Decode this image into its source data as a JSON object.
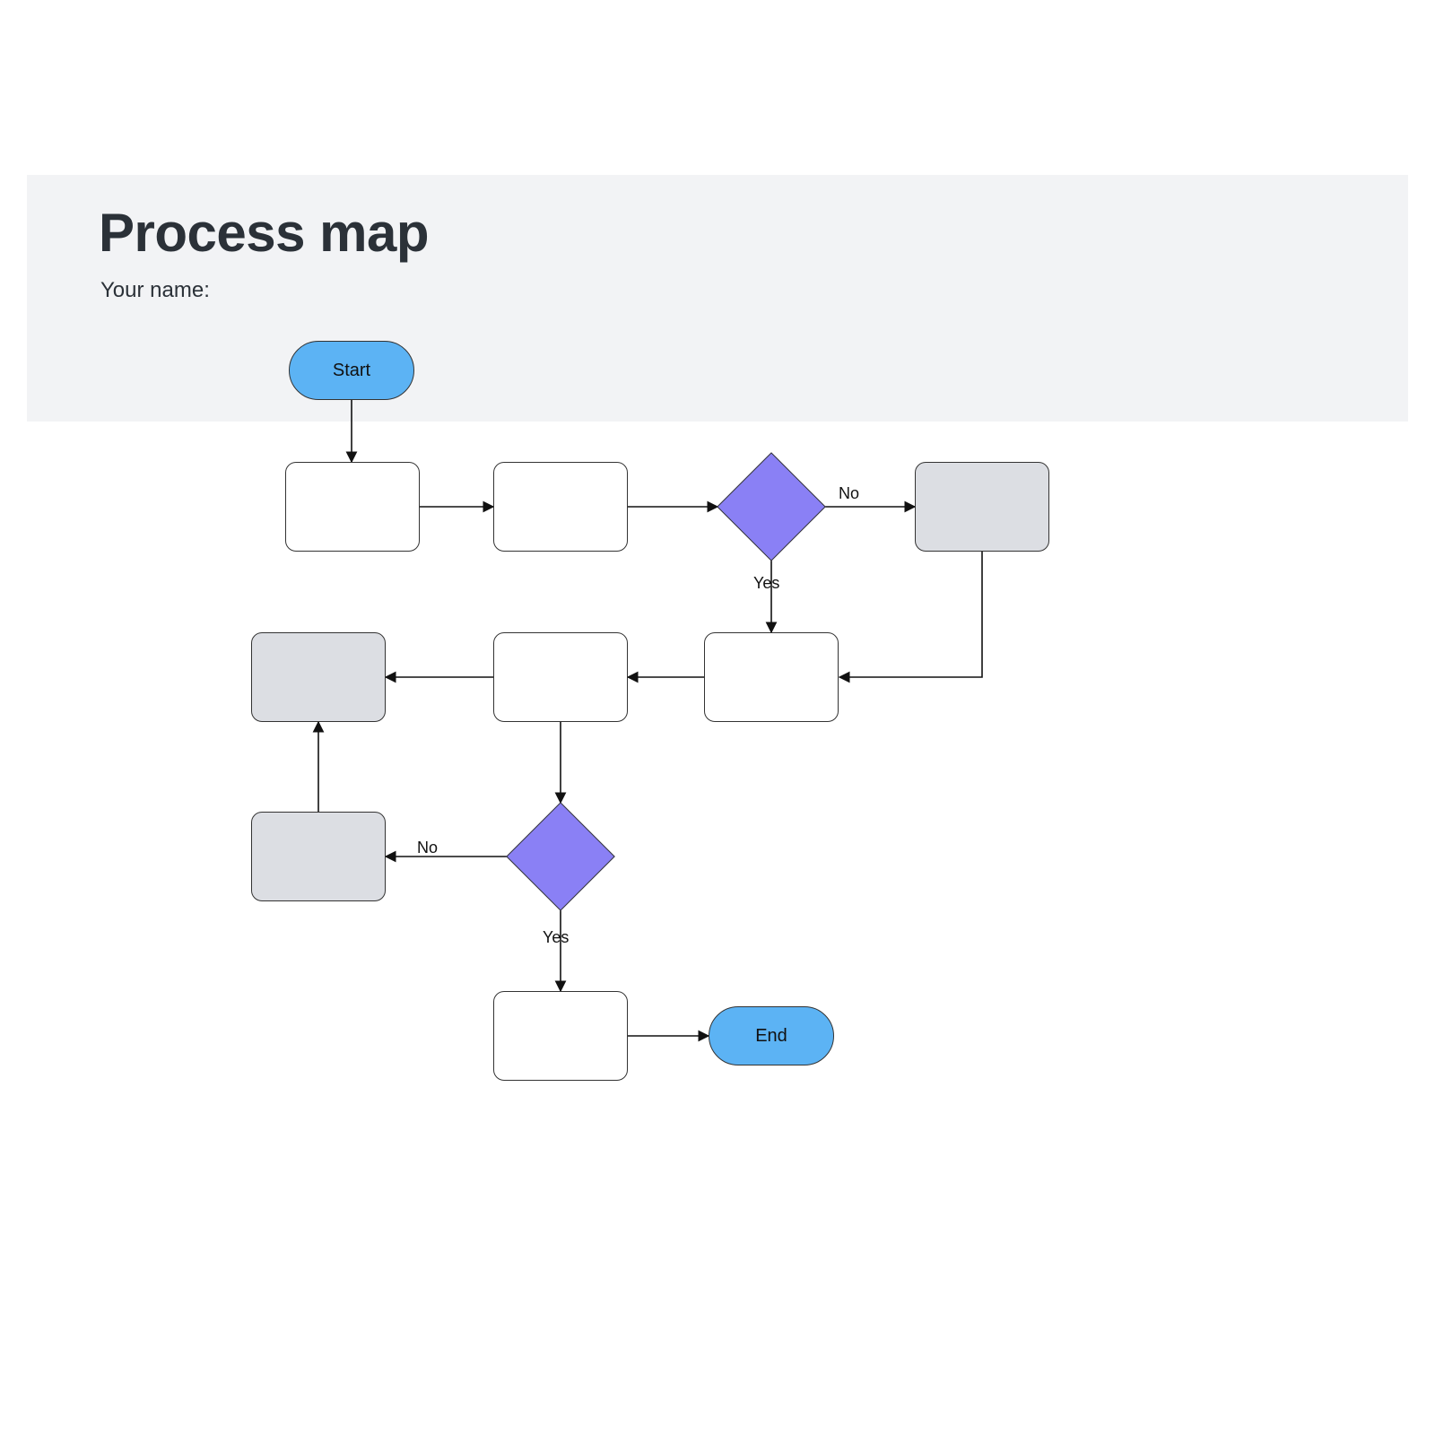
{
  "header": {
    "title": "Process map",
    "subtitle": "Your name:"
  },
  "nodes": {
    "start": {
      "label": "Start"
    },
    "end": {
      "label": "End"
    },
    "p1": {
      "label": ""
    },
    "p2": {
      "label": ""
    },
    "d1": {
      "label": ""
    },
    "p3": {
      "label": ""
    },
    "p4": {
      "label": ""
    },
    "p5": {
      "label": ""
    },
    "p6": {
      "label": ""
    },
    "d2": {
      "label": ""
    },
    "p7": {
      "label": ""
    },
    "p8": {
      "label": ""
    }
  },
  "edges": {
    "d1_right": "No",
    "d1_down": "Yes",
    "d2_left": "No",
    "d2_down": "Yes"
  },
  "colors": {
    "terminator": "#5cb3f4",
    "decision": "#8a80f5",
    "shaded": "#dcdee3",
    "band": "#f2f3f5"
  }
}
